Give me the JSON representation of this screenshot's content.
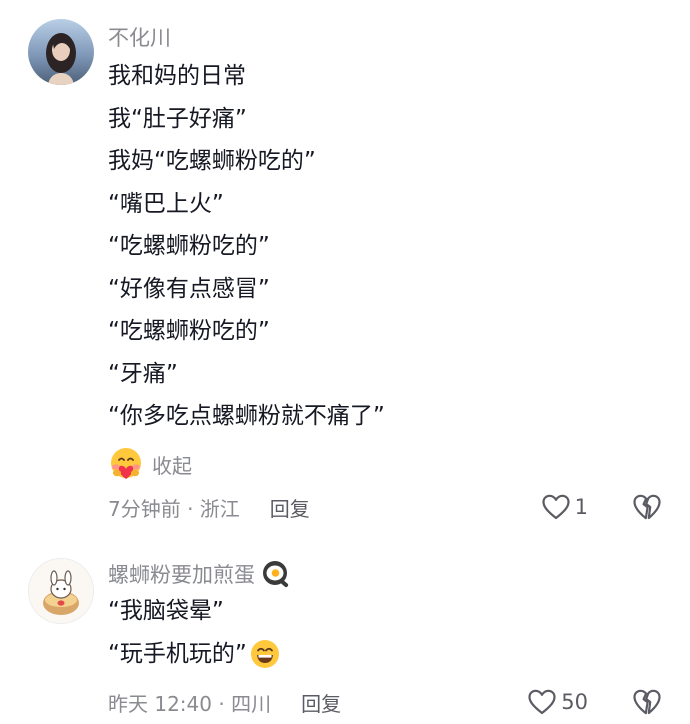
{
  "comments": [
    {
      "author": "不化川",
      "lines": [
        "我和妈的日常",
        "我“肚子好痛”",
        "我妈“吃螺蛳粉吃的”",
        "“嘴巴上火”",
        "“吃螺蛳粉吃的”",
        "“好像有点感冒”",
        "“吃螺蛳粉吃的”",
        "“牙痛”",
        "“你多吃点螺蛳粉就不痛了”"
      ],
      "collapse_label": "收起",
      "time_location": "7分钟前 · 浙江",
      "reply_label": "回复",
      "like_count": "1"
    },
    {
      "author": "螺蛳粉要加煎蛋",
      "lines": [
        "“我脑袋晕”",
        "“玩手机玩的”"
      ],
      "time_location": "昨天 12:40 · 四川",
      "reply_label": "回复",
      "like_count": "50"
    }
  ],
  "icons": {
    "author_emoji": "fried-egg-pan-emoji-icon",
    "sticker_emoji": "heart-hug-face-emoji-icon",
    "inline_emoji": "grinning-face-emoji-icon",
    "like": "heart-outline-icon",
    "dislike": "broken-heart-outline-icon"
  },
  "colors": {
    "text": "#161823",
    "secondary": "#8a8b91",
    "action": "#5b5c63",
    "emoji_yellow": "#ffc83d",
    "heart_red": "#f0324a"
  }
}
